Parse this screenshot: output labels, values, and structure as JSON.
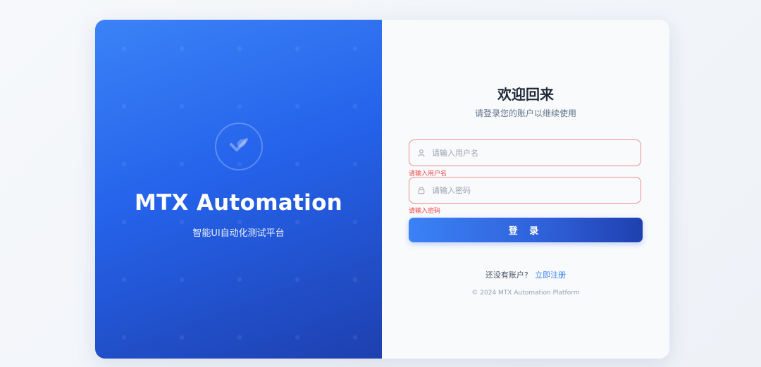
{
  "hero": {
    "logo_icon": "check-hand-icon",
    "title": "MTX Automation",
    "subtitle": "智能UI自动化测试平台"
  },
  "login": {
    "title": "欢迎回来",
    "subtitle": "请登录您的账户以继续使用",
    "username": {
      "icon": "user-icon",
      "placeholder": "请输入用户名",
      "value": "",
      "error": "请输入用户名"
    },
    "password": {
      "icon": "lock-icon",
      "placeholder": "请输入密码",
      "value": "",
      "error": "请输入密码"
    },
    "submit_label": "登 录",
    "register_prompt": "还没有账户?",
    "register_link": "立即注册",
    "copyright": "© 2024 MTX Automation Platform"
  },
  "colors": {
    "brand": "#2563eb",
    "error": "#ef4444",
    "link": "#3b82f6"
  }
}
